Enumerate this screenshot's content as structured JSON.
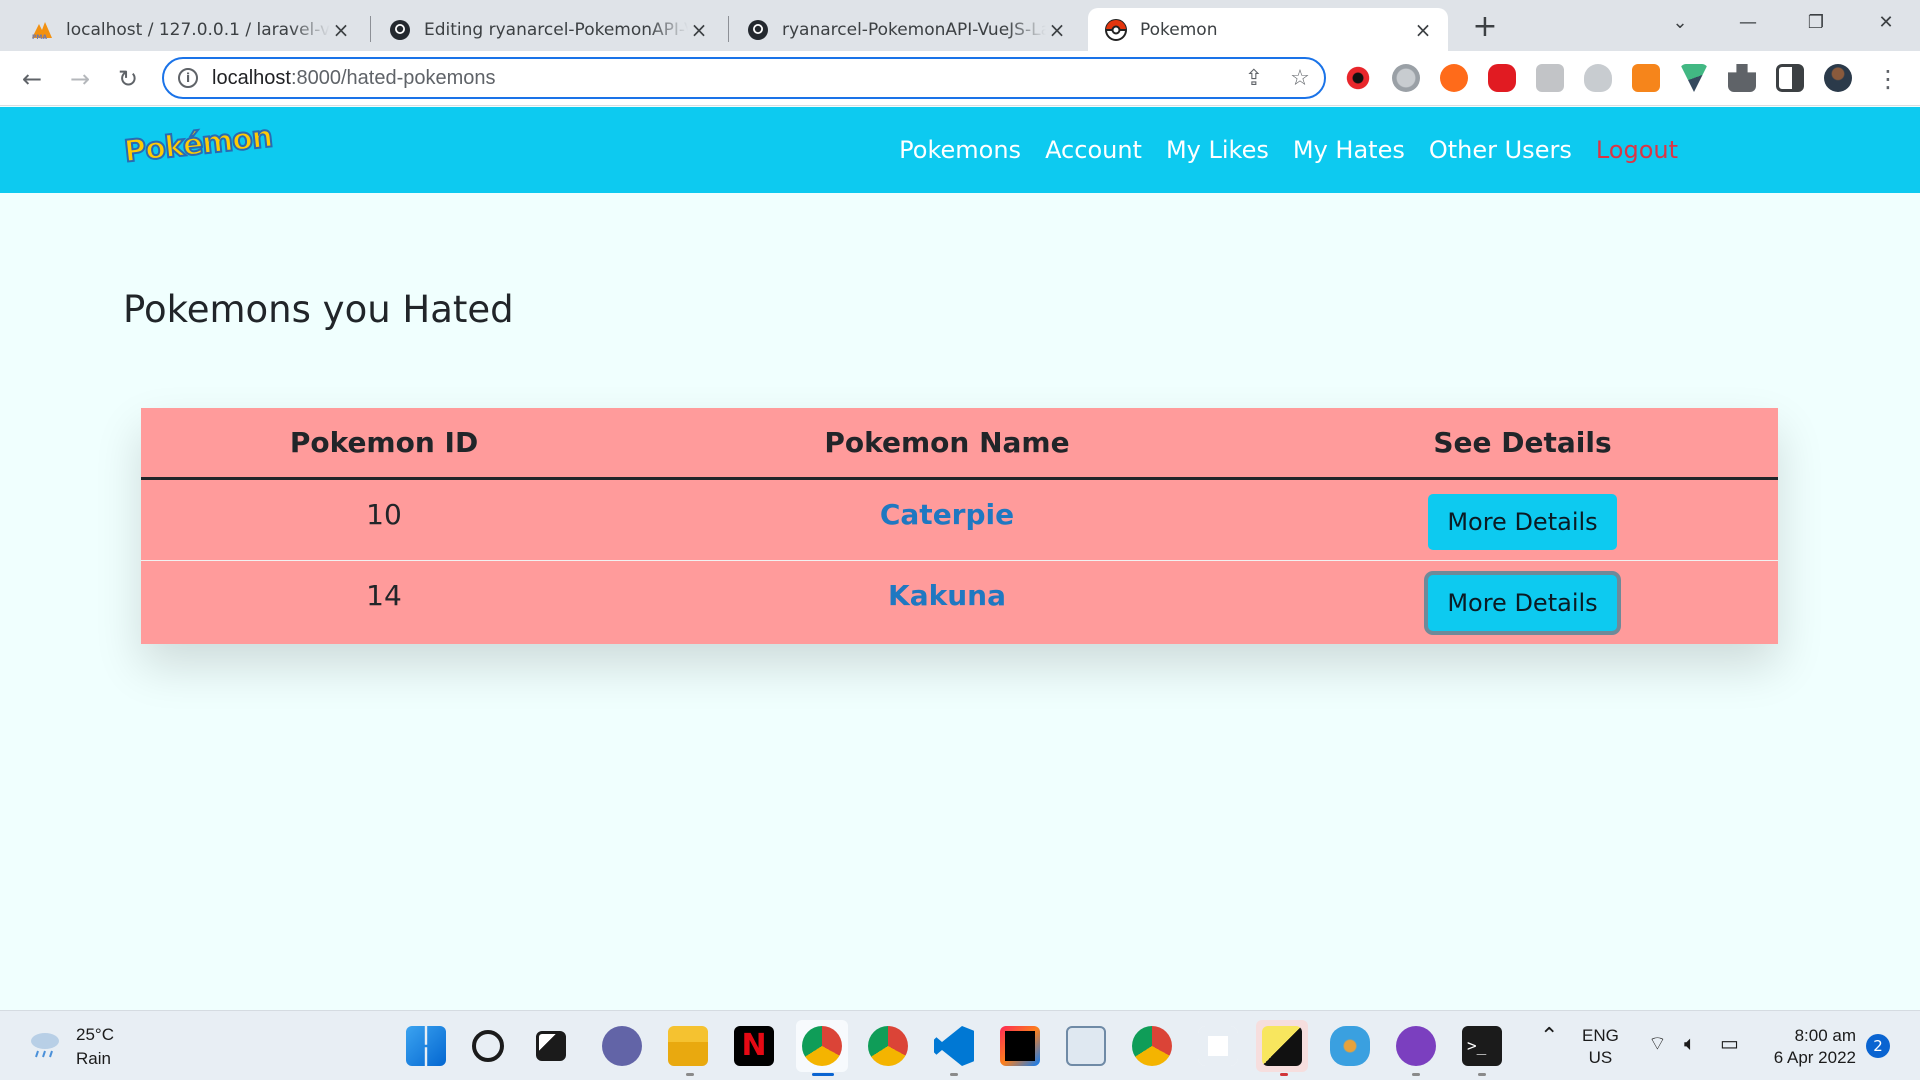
{
  "browser": {
    "tabs": [
      {
        "title": "localhost / 127.0.0.1 / laravel-vue",
        "icon": "phpmyadmin-icon"
      },
      {
        "title": "Editing ryanarcel-PokemonAPI-V",
        "icon": "github-icon"
      },
      {
        "title": "ryanarcel-PokemonAPI-VueJS-La",
        "icon": "github-icon"
      },
      {
        "title": "Pokemon",
        "icon": "pokeball-icon",
        "active": true
      }
    ],
    "url_host": "localhost",
    "url_path": ":8000/hated-pokemons"
  },
  "site": {
    "logo": "Pokémon",
    "nav": [
      "Pokemons",
      "Account",
      "My Likes",
      "My Hates",
      "Other Users",
      "Logout"
    ],
    "colors": {
      "navbar": "#0dcaf0",
      "table": "#ff9b9b",
      "link": "#1f78c1",
      "logout": "#dc3545"
    }
  },
  "main": {
    "title": "Pokemons you Hated",
    "table": {
      "headers": [
        "Pokemon ID",
        "Pokemon Name",
        "See Details"
      ],
      "rows": [
        {
          "id": "10",
          "name": "Caterpie",
          "action": "More Details"
        },
        {
          "id": "14",
          "name": "Kakuna",
          "action": "More Details"
        }
      ]
    }
  },
  "taskbar": {
    "weather_temp": "25°C",
    "weather_desc": "Rain",
    "lang": "ENG",
    "region": "US",
    "time": "8:00 am",
    "date": "6 Apr 2022",
    "notifications": "2"
  }
}
